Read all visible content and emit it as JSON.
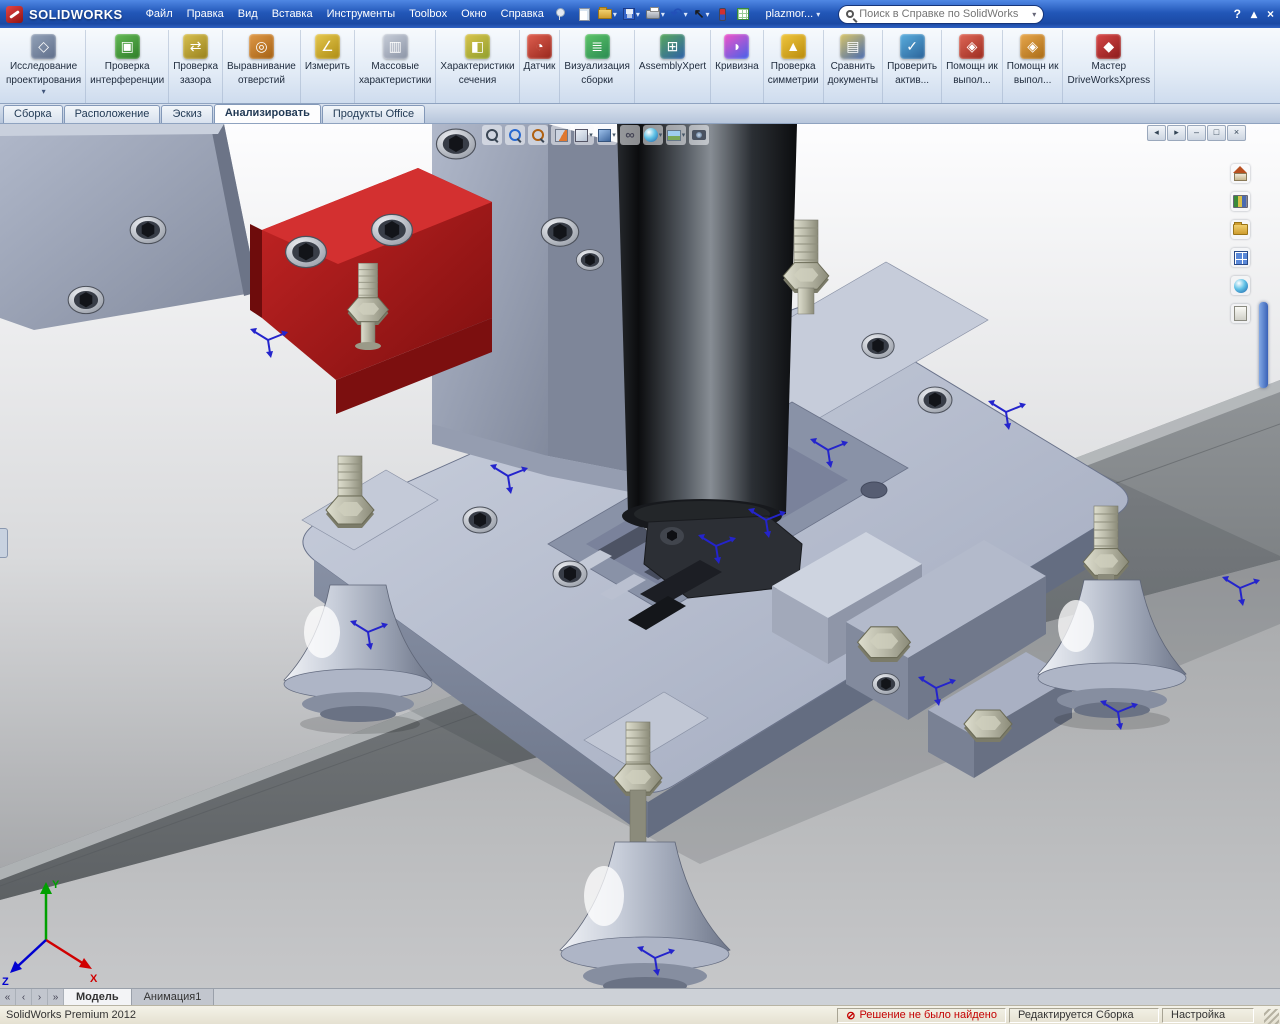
{
  "titlebar": {
    "app_name": "SOLIDWORKS",
    "doc_name": "plazmor...",
    "doc_dd": "▾",
    "search_placeholder": "Поиск в Справке по SolidWorks",
    "search_dd": "▾",
    "help_glyph": "?",
    "collapse_glyph": "▴",
    "close_glyph": "×"
  },
  "menubar": {
    "items": [
      {
        "label": "Файл"
      },
      {
        "label": "Правка"
      },
      {
        "label": "Вид"
      },
      {
        "label": "Вставка"
      },
      {
        "label": "Инструменты"
      },
      {
        "label": "Toolbox"
      },
      {
        "label": "Окно"
      },
      {
        "label": "Справка"
      }
    ]
  },
  "qat": {
    "items": [
      {
        "icon": "new-doc"
      },
      {
        "icon": "open",
        "dd": "▾"
      },
      {
        "icon": "save",
        "dd": "▾"
      },
      {
        "icon": "print",
        "dd": "▾"
      },
      {
        "icon": "undo",
        "dd": "▾"
      },
      {
        "icon": "select",
        "dd": "▾"
      },
      {
        "icon": "rebuild"
      },
      {
        "icon": "sheet"
      }
    ]
  },
  "ribbon": {
    "items": [
      {
        "l1": "Исследование",
        "l2": "проектирования",
        "glyph": "◇",
        "c1": "#93a2b8",
        "c2": "#5f6e8a",
        "dd": "▾"
      },
      {
        "l1": "Проверка",
        "l2": "интерференции",
        "glyph": "▣",
        "c1": "#63b955",
        "c2": "#2e7d28"
      },
      {
        "l1": "Проверка",
        "l2": "зазора",
        "glyph": "⇄",
        "c1": "#d8c050",
        "c2": "#97801c"
      },
      {
        "l1": "Выравнивание",
        "l2": "отверстий",
        "glyph": "◎",
        "c1": "#e09a48",
        "c2": "#a35f12"
      },
      {
        "l1": "Измерить",
        "glyph": "∠",
        "c1": "#e6c84e",
        "c2": "#ad8c14"
      },
      {
        "l1": "Массовые",
        "l2": "характеристики",
        "glyph": "▥",
        "c1": "#c7cdd8",
        "c2": "#8b94a6"
      },
      {
        "l1": "Характеристики",
        "l2": "сечения",
        "glyph": "◧",
        "c1": "#d9c44c",
        "c2": "#8f9e2c"
      },
      {
        "l1": "Датчик",
        "glyph": "◔",
        "c1": "#e06050",
        "c2": "#97261c"
      },
      {
        "l1": "Визуализация",
        "l2": "сборки",
        "glyph": "≣",
        "c1": "#5cc468",
        "c2": "#2a8a52"
      },
      {
        "l1": "AssemblyXpert",
        "glyph": "⊞",
        "c1": "#58a85c",
        "c2": "#2d5fa8"
      },
      {
        "l1": "Кривизна",
        "glyph": "◗",
        "c1": "#f052c8",
        "c2": "#4462e8"
      },
      {
        "l1": "Проверка",
        "l2": "симметрии",
        "glyph": "▲",
        "c1": "#f0c63e",
        "c2": "#b88a0a"
      },
      {
        "l1": "Сравнить",
        "l2": "документы",
        "glyph": "▤",
        "c1": "#d8c568",
        "c2": "#4a6cb0"
      },
      {
        "l1": "Проверить",
        "l2": "актив...",
        "glyph": "✓",
        "c1": "#5aaede",
        "c2": "#2a6298"
      },
      {
        "l1": "Помощн ик",
        "l2": "выпол...",
        "glyph": "◈",
        "c1": "#e06858",
        "c2": "#9a2a1e"
      },
      {
        "l1": "Помощн ик",
        "l2": "выпол...",
        "glyph": "◈",
        "c1": "#e8a84e",
        "c2": "#a86a14"
      },
      {
        "l1": "Мастер",
        "l2": "DriveWorksXpress",
        "glyph": "◆",
        "c1": "#d84848",
        "c2": "#8a1a1a"
      }
    ]
  },
  "command_tabs": {
    "items": [
      {
        "label": "Сборка"
      },
      {
        "label": "Расположение"
      },
      {
        "label": "Эскиз"
      },
      {
        "label": "Анализировать",
        "active": true
      },
      {
        "label": "Продукты Office"
      }
    ]
  },
  "hud": {
    "items": [
      {
        "icon": "zoom-fit"
      },
      {
        "icon": "zoom-area"
      },
      {
        "icon": "zoom-prev"
      },
      {
        "icon": "section"
      },
      {
        "icon": "orientation",
        "dd": "▾"
      },
      {
        "icon": "display",
        "dd": "▾"
      },
      {
        "icon": "hide-show"
      },
      {
        "icon": "appearance",
        "dd": "▾"
      },
      {
        "icon": "scene",
        "dd": "▾"
      },
      {
        "icon": "camera"
      }
    ]
  },
  "viewport_controls": {
    "items": [
      {
        "glyph": "◂"
      },
      {
        "glyph": "▸"
      },
      {
        "glyph": "–"
      },
      {
        "glyph": "□"
      },
      {
        "glyph": "×"
      }
    ]
  },
  "taskpane": {
    "items": [
      {
        "icon": "home"
      },
      {
        "icon": "library"
      },
      {
        "icon": "folder"
      },
      {
        "icon": "palette"
      },
      {
        "icon": "appearance"
      },
      {
        "icon": "properties"
      }
    ]
  },
  "scene": {
    "axis_x": "X",
    "axis_y": "Y",
    "axis_z": "Z"
  },
  "model_tabs": {
    "nav": [
      {
        "glyph": "«"
      },
      {
        "glyph": "‹"
      },
      {
        "glyph": "›"
      },
      {
        "glyph": "»"
      }
    ],
    "items": [
      {
        "label": "Модель",
        "active": true
      },
      {
        "label": "Анимация1"
      }
    ]
  },
  "statusbar": {
    "app": "SolidWorks Premium 2012",
    "warning_glyph": "⊘",
    "warning": "Решение не было найдено",
    "mode": "Редактируется Сборка",
    "settings": "Настройка"
  }
}
